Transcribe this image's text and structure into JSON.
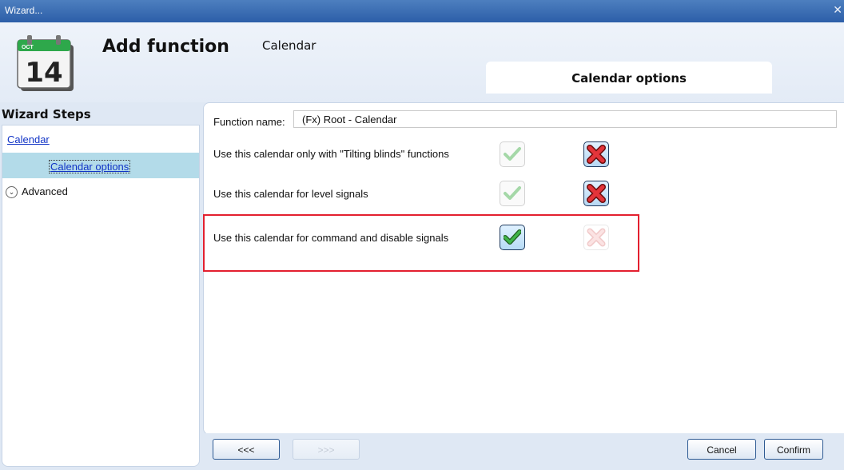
{
  "window": {
    "title": "Wizard...",
    "close_icon": "close-icon"
  },
  "header": {
    "calendar_icon": {
      "month": "OCT",
      "day": "14"
    },
    "title": "Add function",
    "subtitle": "Calendar",
    "active_tab": "Calendar options"
  },
  "sidebar": {
    "title": "Wizard Steps",
    "items": [
      {
        "label": "Calendar"
      },
      {
        "label": "Calendar options",
        "selected": true
      },
      {
        "label": "Advanced",
        "icon": "chevron-down-icon"
      }
    ]
  },
  "form": {
    "function_name_label": "Function name:",
    "function_name_value": "(Fx) Root - Calendar",
    "options": [
      {
        "label": "Use this calendar only with \"Tilting blinds\" functions",
        "value": false
      },
      {
        "label": "Use this calendar for level signals",
        "value": false
      },
      {
        "label": "Use this calendar for command and disable signals",
        "value": true
      }
    ]
  },
  "footer": {
    "prev_label": "<<<",
    "next_label": ">>>",
    "cancel_label": "Cancel",
    "confirm_label": "Confirm"
  },
  "colors": {
    "highlight": "#e3202f",
    "link": "#1033c6",
    "selection": "#b3dbe9"
  }
}
